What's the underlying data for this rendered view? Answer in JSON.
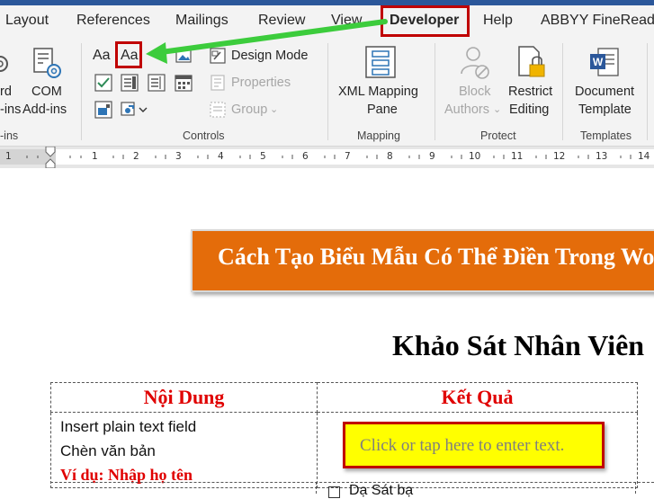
{
  "tabs": [
    "Layout",
    "References",
    "Mailings",
    "Review",
    "View",
    "Developer",
    "Help",
    "ABBYY FineReader"
  ],
  "active_tab": "Developer",
  "ribbon": {
    "addins": {
      "word_addins_lines": [
        "rd",
        "-ins"
      ],
      "com_addins_lines": [
        "COM",
        "Add-ins"
      ],
      "group_label": "-ins"
    },
    "controls": {
      "rich_text_icon": "Aa",
      "plain_text_icon": "Aa",
      "design_mode": "Design Mode",
      "properties": "Properties",
      "group": "Group",
      "group_label": "Controls"
    },
    "mapping": {
      "xml_lines": [
        "XML Mapping",
        "Pane"
      ],
      "group_label": "Mapping"
    },
    "protect": {
      "block_lines": [
        "Block",
        "Authors"
      ],
      "restrict_lines": [
        "Restrict",
        "Editing"
      ],
      "group_label": "Protect"
    },
    "templates": {
      "doc_template_lines": [
        "Document",
        "Template"
      ],
      "group_label": "Templates"
    }
  },
  "ruler": {
    "numbers": [
      "1",
      "1",
      "2",
      "3",
      "4",
      "5",
      "6",
      "7",
      "8",
      "9",
      "10",
      "11",
      "12",
      "13",
      "14"
    ]
  },
  "document": {
    "banner": "Cách Tạo Biểu Mẫu Có Thể Điền Trong Word",
    "title": "Khảo Sát Nhân Viên",
    "table": {
      "headers": [
        "Nội Dung",
        "Kết Quả"
      ],
      "row1": {
        "lines": [
          "Insert plain text field",
          "Chèn văn bản"
        ],
        "example": "Ví dụ: Nhập họ tên",
        "field_placeholder": "Click or tap here to enter text."
      },
      "row2_checkbox_label": "Dạ Sát bạ"
    }
  },
  "colors": {
    "accent_blue": "#2b579a",
    "highlight_red": "#c00000",
    "arrow_green": "#33cc33",
    "banner_orange": "#e46c0a",
    "field_yellow": "#ffff00"
  }
}
